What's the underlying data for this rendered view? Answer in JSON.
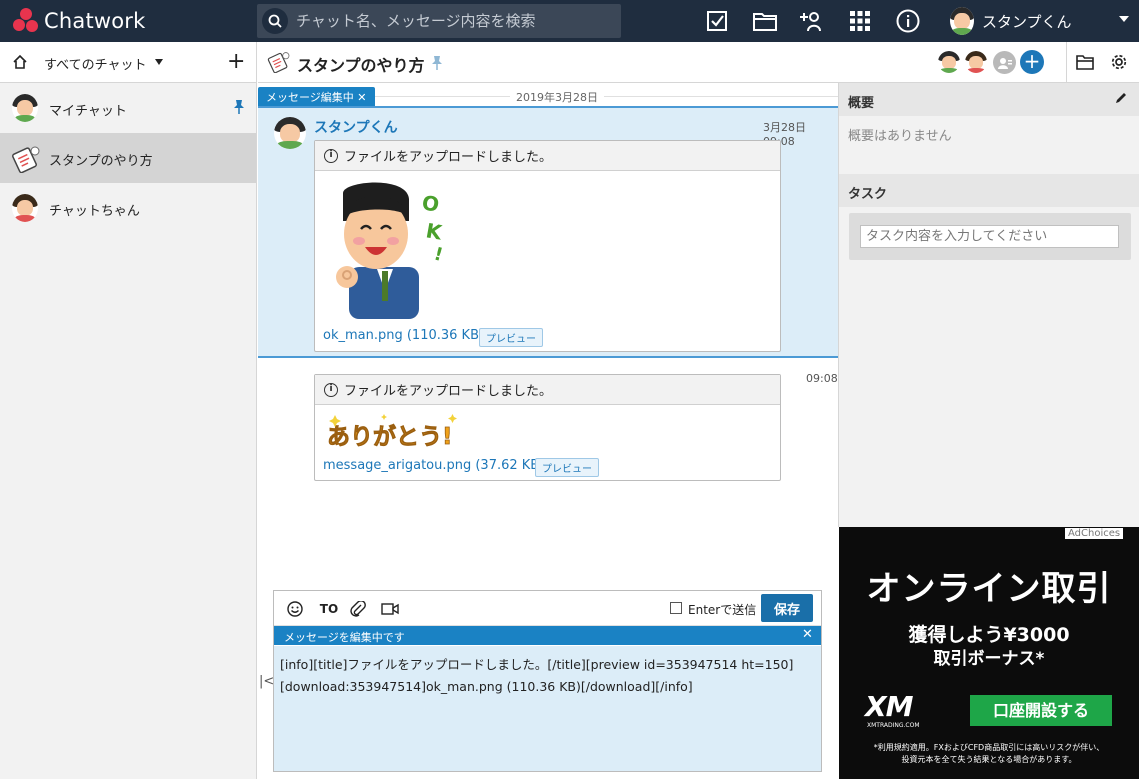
{
  "app": {
    "brand": "Chatwork",
    "accent": "#1d77b8",
    "header_bg": "#1f2d3f"
  },
  "header": {
    "search_placeholder": "チャット名、メッセージ内容を検索",
    "user_name": "スタンプくん",
    "icons": [
      "task-check-icon",
      "folder-icon",
      "add-contact-icon",
      "apps-grid-icon",
      "info-icon"
    ]
  },
  "sidebar": {
    "filter_label": "すべてのチャット",
    "add_label": "+",
    "rooms": [
      {
        "name": "マイチャット",
        "pinned": true,
        "active": false
      },
      {
        "name": "スタンプのやり方",
        "pinned": false,
        "active": true
      },
      {
        "name": "チャットちゃん",
        "pinned": false,
        "active": false
      }
    ]
  },
  "room": {
    "title": "スタンプのやり方",
    "add_member": "+"
  },
  "timeline": {
    "date": "2019年3月28日",
    "editing_tag": "メッセージ編集中 ✕",
    "messages": [
      {
        "sender": "スタンプくん",
        "time": "3月28日 09:08",
        "info_title": "ファイルをアップロードしました。",
        "file": "ok_man.png (110.36 KB)",
        "preview": "プレビュー",
        "sticker_text": "OK!"
      },
      {
        "time": "09:08",
        "info_title": "ファイルをアップロードしました。",
        "file": "message_arigatou.png (37.62 KB)",
        "preview": "プレビュー",
        "sticker_text": "ありがとう!"
      }
    ]
  },
  "composer": {
    "to_label": "TO",
    "enter_label": "Enterで送信",
    "save_label": "保存",
    "editing_label": "メッセージを編集中です",
    "close_label": "✕",
    "text_line1": "[info][title]ファイルをアップロードしました。[/title][preview id=353947514 ht=150]",
    "text_line2": "[download:353947514]ok_man.png (110.36 KB)[/download][/info]",
    "collapse_label": "|<"
  },
  "right_panel": {
    "summary_title": "概要",
    "summary_empty": "概要はありません",
    "task_title": "タスク",
    "task_placeholder": "タスク内容を入力してください"
  },
  "ad": {
    "choices": "AdChoices",
    "headline": "オンライン取引",
    "sub1": "獲得しよう¥3000",
    "sub2": "取引ボーナス*",
    "logo": "XM",
    "logo_sub": "XMTRADING.COM",
    "cta": "口座開設する",
    "fine1": "*利用規約適用。FXおよびCFD商品取引には高いリスクが伴い、",
    "fine2": "投資元本を全て失う結果となる場合があります。"
  }
}
